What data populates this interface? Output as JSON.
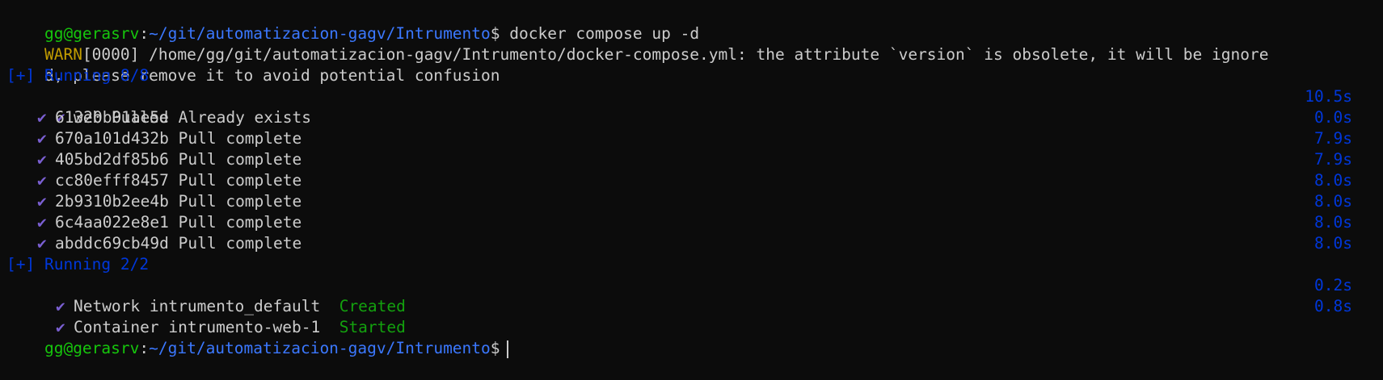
{
  "prompt": {
    "user_host": "gg@gerasrv",
    "sep": ":",
    "path": "~/git/automatizacion-gagv/Intrumento",
    "dollar": "$"
  },
  "command": " docker compose up -d",
  "warn": {
    "tag": "WARN",
    "code": "[0000]",
    "message": " /home/gg/git/automatizacion-gagv/Intrumento/docker-compose.yml: the attribute `version` is obsolete, it will be ignore",
    "message_cont": "d, please remove it to avoid potential confusion"
  },
  "running1": "[+] Running 8/8",
  "web_pulled": {
    "check": "✔",
    "label": "web Pulled",
    "time": "10.5s"
  },
  "layers": [
    {
      "check": "✔",
      "id": "61320b01ae5e",
      "status": " Already exists",
      "time": "0.0s"
    },
    {
      "check": "✔",
      "id": "670a101d432b",
      "status": " Pull complete",
      "time": "7.9s"
    },
    {
      "check": "✔",
      "id": "405bd2df85b6",
      "status": " Pull complete",
      "time": "7.9s"
    },
    {
      "check": "✔",
      "id": "cc80efff8457",
      "status": " Pull complete",
      "time": "8.0s"
    },
    {
      "check": "✔",
      "id": "2b9310b2ee4b",
      "status": " Pull complete",
      "time": "8.0s"
    },
    {
      "check": "✔",
      "id": "6c4aa022e8e1",
      "status": " Pull complete",
      "time": "8.0s"
    },
    {
      "check": "✔",
      "id": "abddc69cb49d",
      "status": " Pull complete",
      "time": "8.0s"
    }
  ],
  "running2": "[+] Running 2/2",
  "network": {
    "check": "✔",
    "label": "Network intrumento_default  ",
    "state": "Created",
    "time": "0.2s"
  },
  "container": {
    "check": "✔",
    "label": "Container intrumento-web-1  ",
    "state": "Started",
    "time": "0.8s"
  },
  "colors": {
    "background": "#0c0c0c",
    "prompt_user": "#16c60c",
    "prompt_path": "#3b78ff",
    "warn": "#c19c00",
    "timing": "#0037da",
    "check": "#7a5fd1",
    "state": "#13a10e"
  }
}
